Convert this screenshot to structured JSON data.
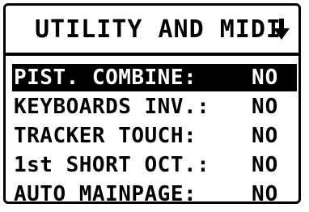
{
  "header": {
    "title": "UTILITY AND MIDI",
    "scroll_icon": "down-arrow-icon"
  },
  "menu": {
    "items": [
      {
        "label": "PIST. COMBINE:",
        "value": "NO",
        "selected": true
      },
      {
        "label": "KEYBOARDS INV.:",
        "value": "NO",
        "selected": false
      },
      {
        "label": "TRACKER TOUCH:",
        "value": "NO",
        "selected": false
      },
      {
        "label": "1st SHORT OCT.:",
        "value": "NO",
        "selected": false
      },
      {
        "label": "AUTO MAINPAGE:",
        "value": "NO",
        "selected": false
      }
    ]
  },
  "colors": {
    "foreground": "#000000",
    "background": "#ffffff",
    "highlight": "#000000"
  }
}
